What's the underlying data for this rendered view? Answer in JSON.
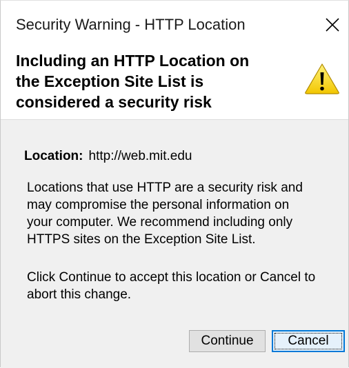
{
  "window": {
    "title": "Security Warning - HTTP Location",
    "close_icon": "close-icon"
  },
  "header": {
    "title": "Including an HTTP Location on\nthe Exception Site List is\nconsidered a security risk",
    "icon": "warning-icon",
    "icon_color": "#f6d40c"
  },
  "body": {
    "location_label": "Location:",
    "location_value": "http://web.mit.edu",
    "paragraph1": "Locations that use HTTP are a security risk and\nmay compromise the personal information on\nyour computer.  We recommend including only\nHTTPS sites on the Exception Site List.",
    "paragraph2": "Click Continue to accept this location or Cancel to\nabort this change."
  },
  "buttons": {
    "continue_label": "Continue",
    "cancel_label": "Cancel"
  },
  "colors": {
    "focus_border": "#0078d7",
    "button_bg": "#e1e1e1",
    "dialog_bg": "#f0f0f0"
  }
}
